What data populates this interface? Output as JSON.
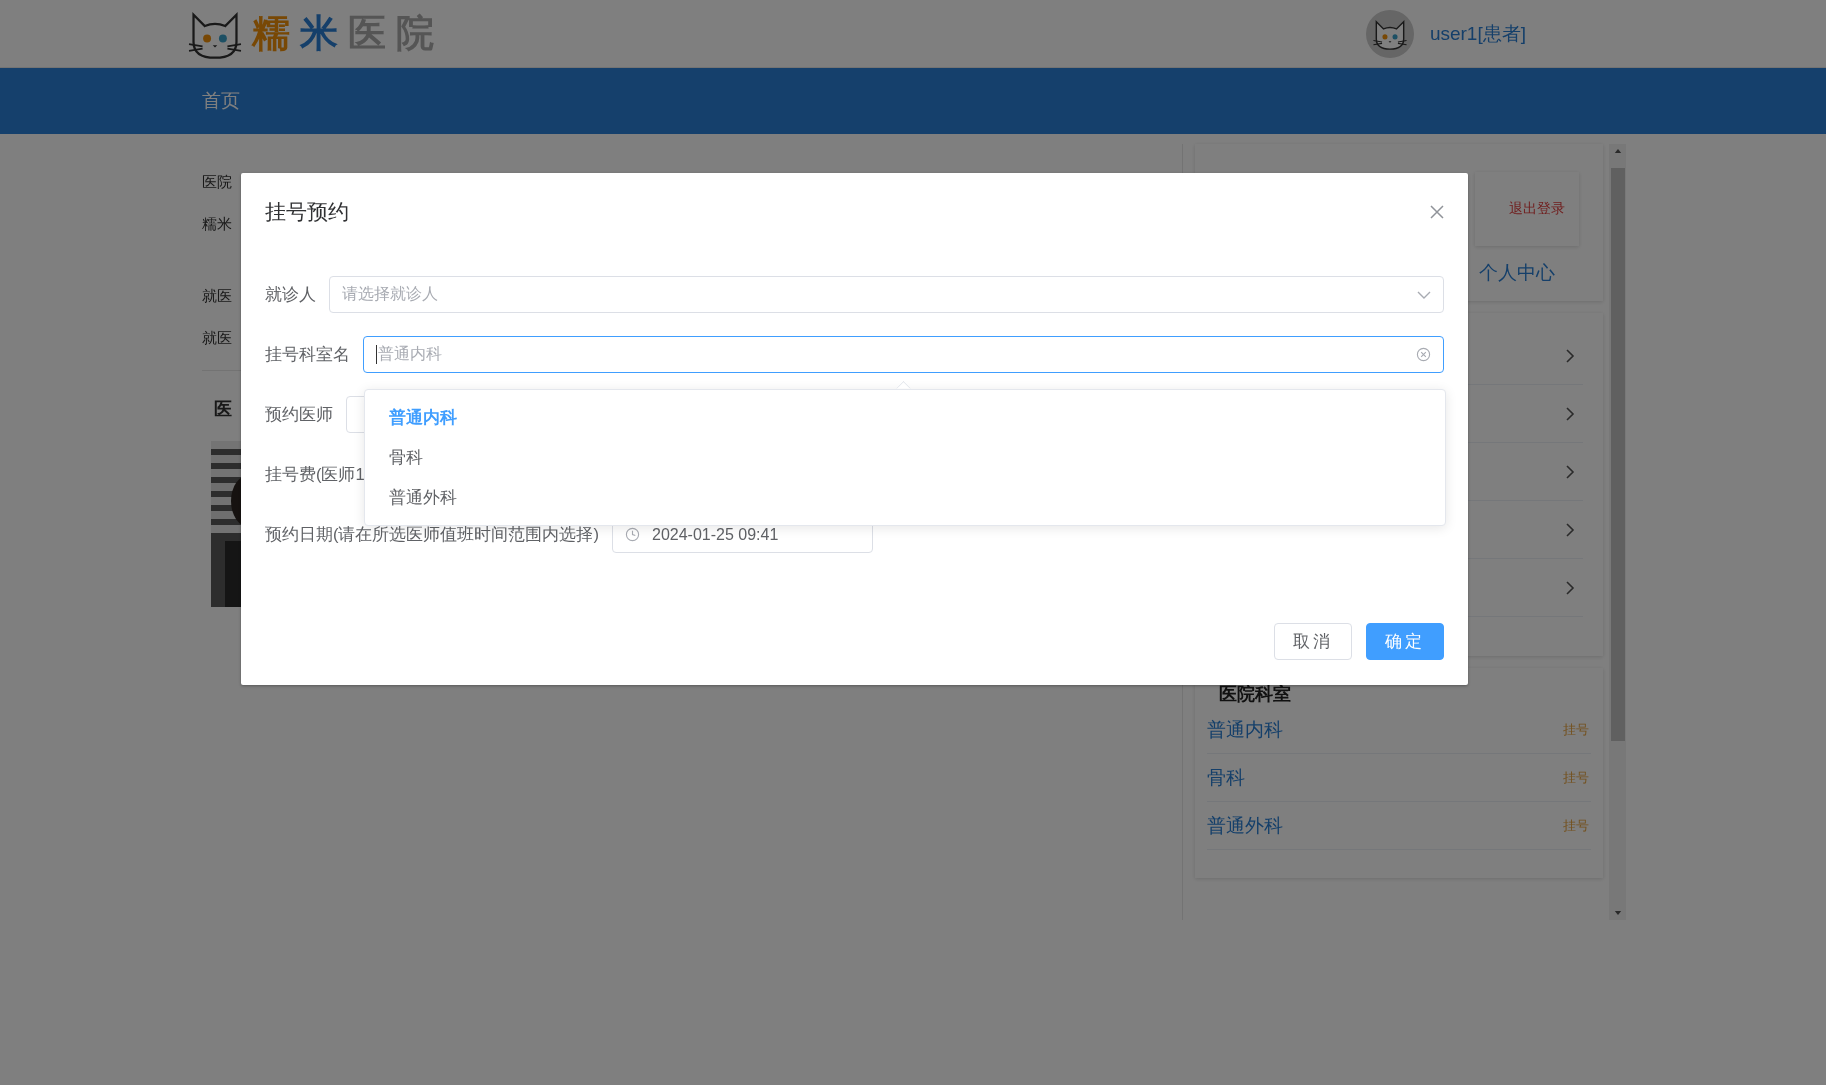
{
  "header": {
    "logo": "糯米医院",
    "user": "user1[患者]"
  },
  "nav": {
    "items": [
      {
        "label": "首页",
        "selected": true
      }
    ]
  },
  "main": {
    "lines": [
      "医院",
      "糯米",
      "就医",
      "就医"
    ],
    "section_title": "医"
  },
  "sidebar": {
    "logout": "退出登录",
    "profile": "个人中心",
    "menu_rows": [
      {
        "kind": "link"
      },
      {
        "kind": "link"
      },
      {
        "kind": "link"
      },
      {
        "kind": "link"
      },
      {
        "kind": "link"
      }
    ],
    "departments_title": "医院科室",
    "departments": [
      {
        "name": "普通内科",
        "action": "挂号"
      },
      {
        "name": "骨科",
        "action": "挂号"
      },
      {
        "name": "普通外科",
        "action": "挂号"
      }
    ]
  },
  "dialog": {
    "title": "挂号预约",
    "fields": [
      {
        "kind": "select",
        "label": "就诊人",
        "placeholder": "请选择就诊人"
      },
      {
        "kind": "input",
        "label": "挂号科室名",
        "placeholder": "普通内科",
        "focused": true
      },
      {
        "kind": "blank",
        "label": "预约医师"
      },
      {
        "kind": "text",
        "label": "挂号费(医师1"
      },
      {
        "kind": "date",
        "label": "预约日期(请在所选医师值班时间范围内选择)",
        "value": "2024-01-25 09:41"
      }
    ],
    "dropdown": [
      {
        "label": "普通内科",
        "selected": true
      },
      {
        "label": "骨科",
        "selected": false
      },
      {
        "label": "普通外科",
        "selected": false
      }
    ],
    "buttons": [
      {
        "label": "取消",
        "kind": "default"
      },
      {
        "label": "确定",
        "kind": "primary"
      }
    ]
  }
}
